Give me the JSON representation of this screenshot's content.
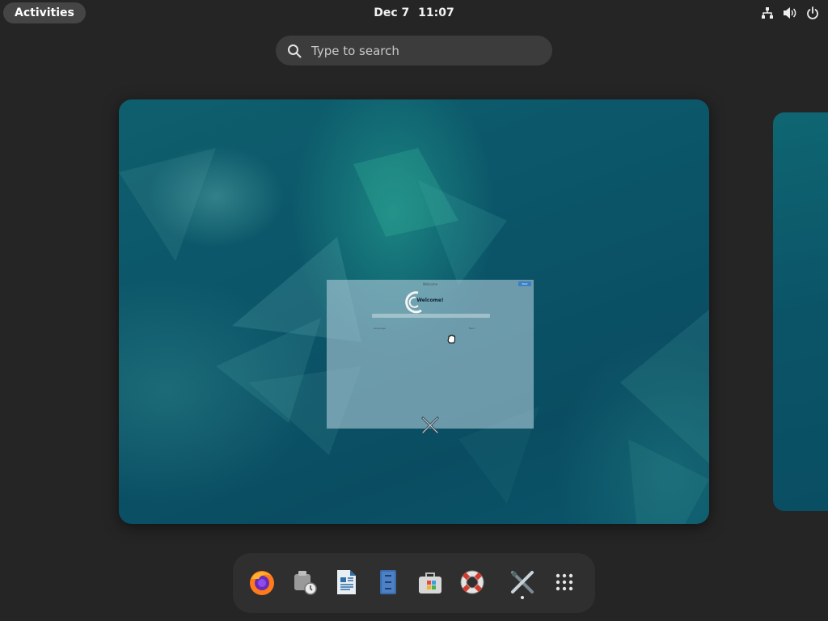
{
  "topbar": {
    "activities_label": "Activities",
    "date": "Dec 7",
    "time": "11:07",
    "tray_icons": [
      "network-wired-icon",
      "volume-icon",
      "power-icon"
    ]
  },
  "search": {
    "placeholder": "Type to search"
  },
  "window_preview": {
    "title_text": "Welcome",
    "heading": "Welcome!",
    "button_text": "Next",
    "left_hint": "Language",
    "right_hint": "Next"
  },
  "dash": {
    "apps": [
      {
        "name": "firefox",
        "icon": "firefox-icon",
        "running": false
      },
      {
        "name": "software-update",
        "icon": "software-update-icon",
        "running": false
      },
      {
        "name": "writer",
        "icon": "writer-document-icon",
        "running": false
      },
      {
        "name": "files",
        "icon": "files-cabinet-icon",
        "running": false
      },
      {
        "name": "software",
        "icon": "software-bag-icon",
        "running": false
      },
      {
        "name": "help",
        "icon": "help-lifebuoy-icon",
        "running": false
      },
      {
        "name": "settings-tweaks",
        "icon": "tools-icon",
        "running": true
      },
      {
        "name": "show-apps",
        "icon": "app-grid-icon",
        "running": false
      }
    ]
  },
  "colors": {
    "panel_bg": "#252525",
    "accent": "#3b7fc4",
    "wallpaper": "#0b5468"
  }
}
